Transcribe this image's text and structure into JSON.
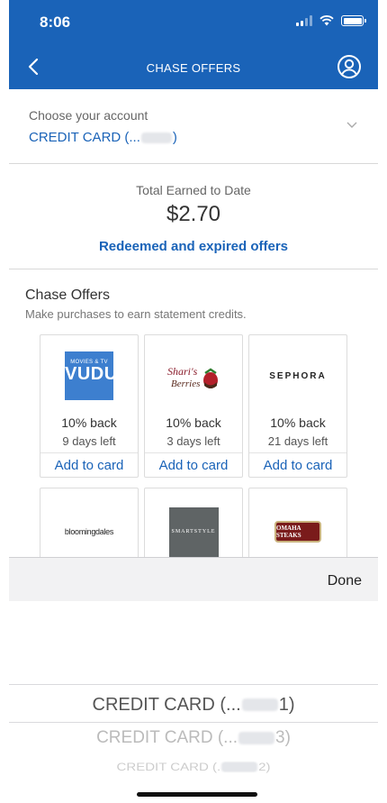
{
  "status_bar": {
    "time": "8:06"
  },
  "header": {
    "title": "CHASE OFFERS"
  },
  "account": {
    "label": "Choose your account",
    "value_prefix": "CREDIT CARD (...",
    "value_suffix": ")"
  },
  "earned": {
    "label": "Total Earned to Date",
    "amount": "$2.70",
    "link": "Redeemed and expired offers"
  },
  "offers": {
    "title": "Chase Offers",
    "subtitle": "Make purchases to earn statement credits.",
    "cards": [
      {
        "merchant": "VUDU",
        "logo_sub": "MOVIES & TV",
        "back": "10% back",
        "days": "9 days left",
        "action": "Add to card"
      },
      {
        "merchant": "Shari's Berries",
        "back": "10% back",
        "days": "3 days left",
        "action": "Add to card"
      },
      {
        "merchant": "SEPHORA",
        "back": "10% back",
        "days": "21 days left",
        "action": "Add to card"
      },
      {
        "merchant": "bloomingdales"
      },
      {
        "merchant": "SMARTSTYLE"
      },
      {
        "merchant": "OMAHA STEAKS"
      }
    ]
  },
  "picker": {
    "done_label": "Done",
    "options": [
      {
        "prefix": "CREDIT CARD (...",
        "suffix": "1)"
      },
      {
        "prefix": "CREDIT CARD (...",
        "suffix": "3)"
      },
      {
        "prefix": "CREDIT CARD (.",
        "suffix": "2)"
      }
    ]
  },
  "colors": {
    "brand_blue": "#1a63b8",
    "link_blue": "#1a63b8"
  }
}
